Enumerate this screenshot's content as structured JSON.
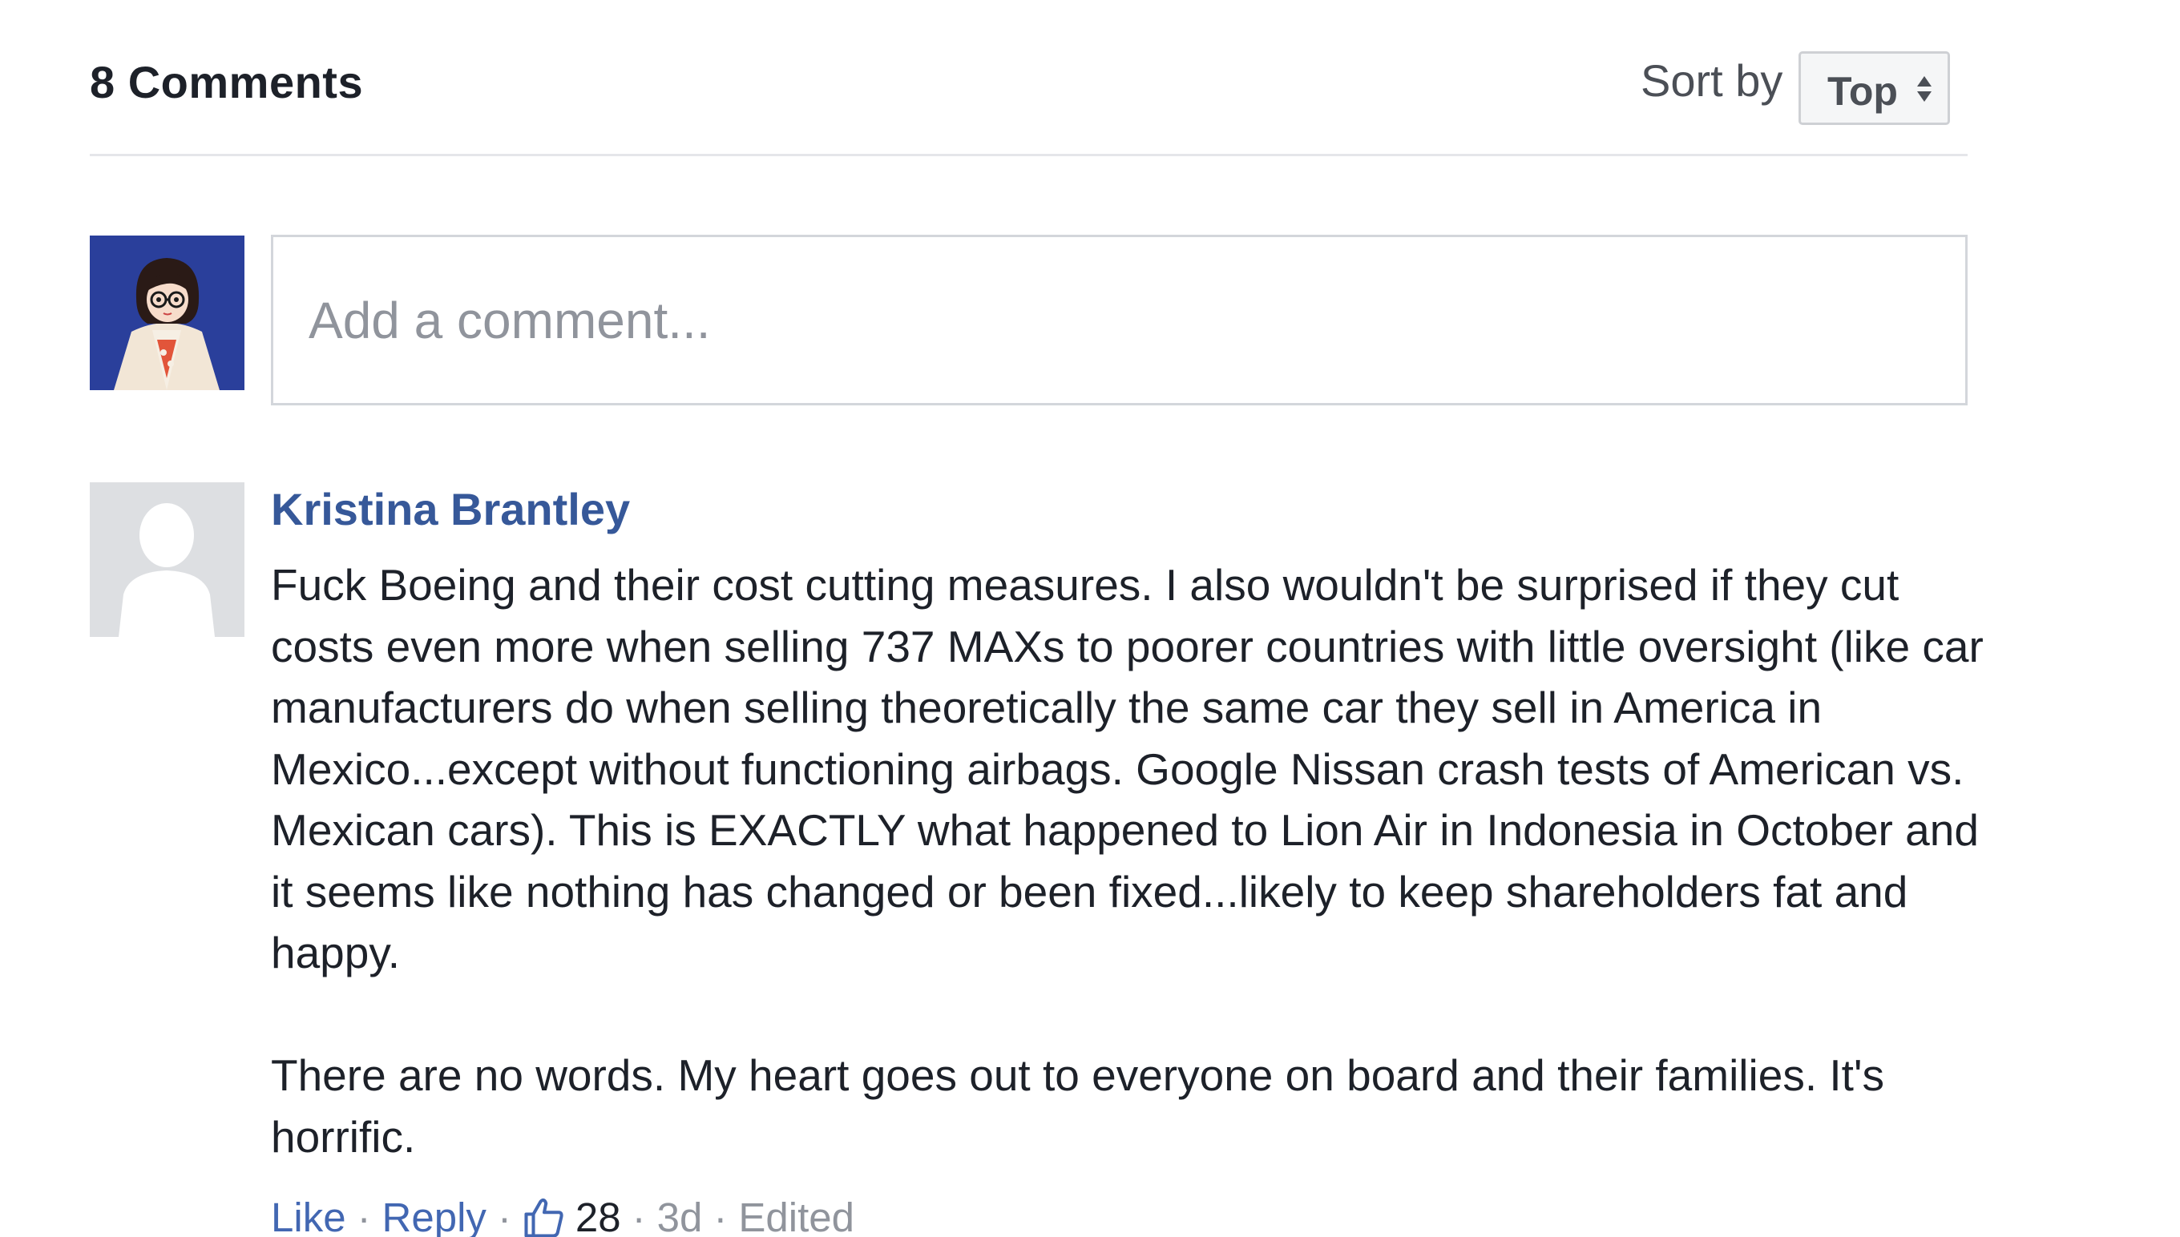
{
  "header": {
    "comment_count": "8 Comments",
    "sort_label": "Sort by",
    "sort_value": "Top"
  },
  "composer": {
    "placeholder": "Add a comment..."
  },
  "comments": [
    {
      "author": "Kristina Brantley",
      "paragraphs": [
        "Fuck Boeing and their cost cutting measures. I also wouldn't be surprised if they cut costs even more when selling 737 MAXs to poorer countries with little oversight (like car manufacturers do when selling theoretically the same car they sell in America in Mexico...except without functioning airbags. Google Nissan crash tests of American vs. Mexican cars). This is EXACTLY what happened to Lion Air in Indonesia in October and it seems like nothing has changed or been fixed...likely to keep shareholders fat and happy.",
        "There are no words. My heart goes out to everyone on board and their families. It's horrific."
      ],
      "like_label": "Like",
      "reply_label": "Reply",
      "like_count": "28",
      "age": "3d",
      "edited": "Edited"
    }
  ],
  "colors": {
    "link": "#4267b2",
    "author": "#365899",
    "text": "#1d2129",
    "muted": "#90949c"
  },
  "icons": {
    "sort": "sort-arrows-icon",
    "like": "thumbs-up-icon",
    "default_avatar": "silhouette-avatar"
  }
}
